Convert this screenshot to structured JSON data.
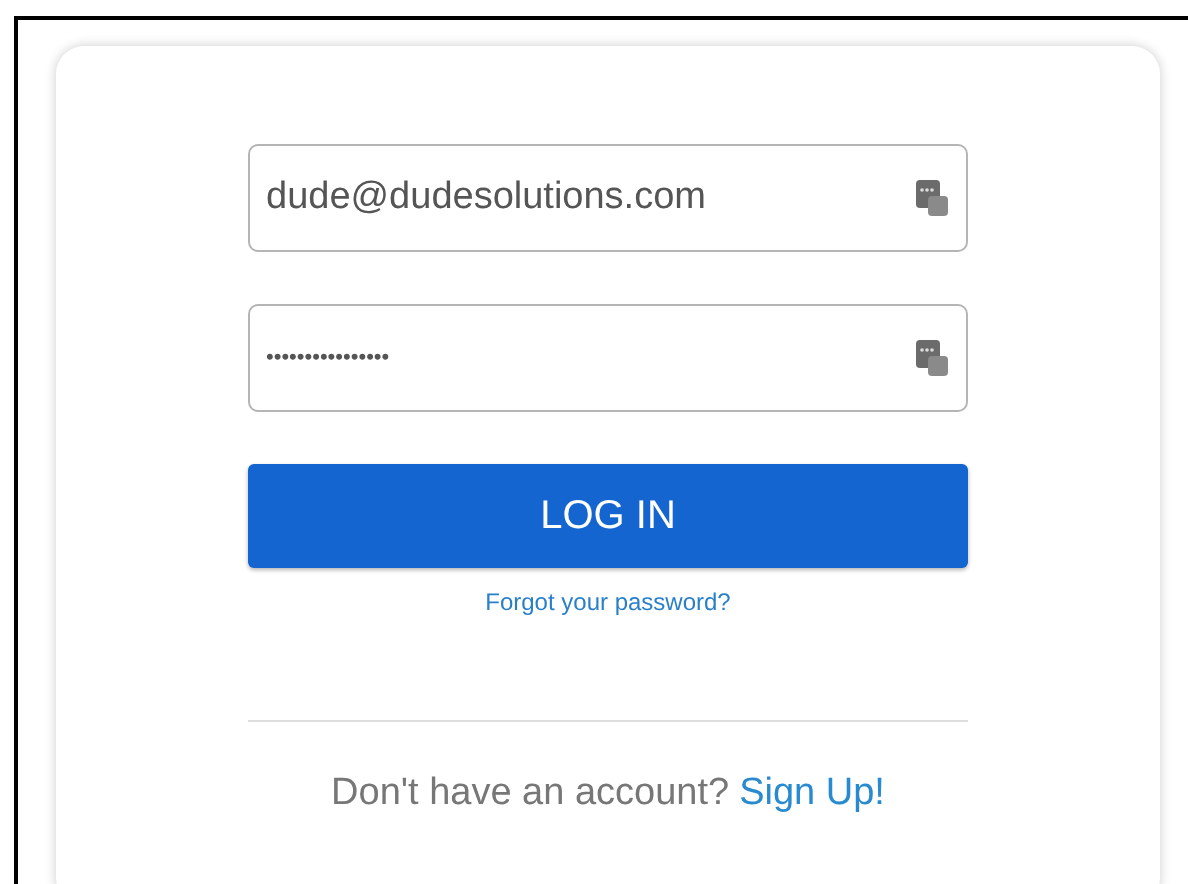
{
  "login_form": {
    "email_field": {
      "value": "dude@dudesolutions.com"
    },
    "password_field": {
      "value": "••••••••••••••••"
    },
    "login_button": "LOG IN",
    "forgot_password_link": "Forgot your password?",
    "signup_prompt": {
      "text": "Don't have an account?",
      "link": "Sign Up!"
    }
  }
}
